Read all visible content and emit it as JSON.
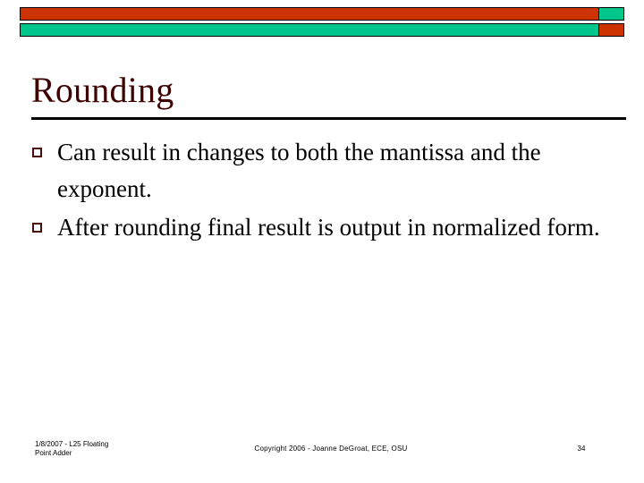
{
  "slide": {
    "title": "Rounding",
    "bullets": [
      {
        "marker": "hollow-square",
        "text": "Can result in changes to both the mantissa and the exponent."
      },
      {
        "marker": "hollow-square",
        "text": "After rounding final result is output in normalized form."
      }
    ],
    "footer": {
      "left_line1": "1/8/2007 - L25 Floating",
      "left_line2": "Point Adder",
      "center": "Copyright 2006 - Joanne DeGroat, ECE, OSU",
      "page_number": "34"
    },
    "banner": {
      "top_band_color": "#cc3300",
      "top_cap_color": "#00c68c",
      "bottom_band_color": "#00c68c",
      "bottom_cap_color": "#cc3300",
      "border_color": "#000000"
    },
    "colors": {
      "title": "#3d0000",
      "bullet_marker": "#4a0d0d",
      "body_text": "#000000",
      "rule": "#000000",
      "background": "#ffffff"
    }
  }
}
